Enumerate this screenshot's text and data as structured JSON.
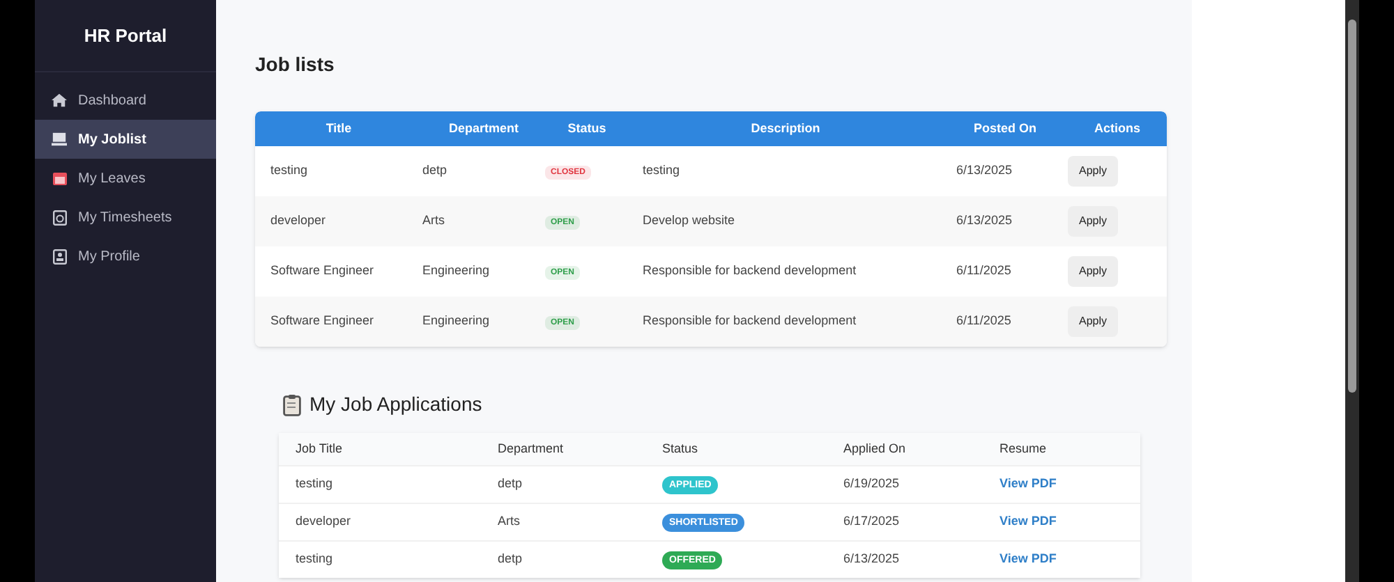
{
  "sidebar": {
    "title": "HR Portal",
    "items": [
      {
        "label": "Dashboard",
        "selected": false
      },
      {
        "label": "My Joblist",
        "selected": true
      },
      {
        "label": "My Leaves",
        "selected": false
      },
      {
        "label": "My Timesheets",
        "selected": false
      },
      {
        "label": "My Profile",
        "selected": false
      }
    ]
  },
  "job_list": {
    "title": "Job lists",
    "columns": [
      "Title",
      "Department",
      "Status",
      "Description",
      "Posted On",
      "Actions"
    ],
    "rows": [
      {
        "title": "testing",
        "department": "detp",
        "status": "CLOSED",
        "color": "#e0353f",
        "description": "testing",
        "posted_on": "6/13/2025",
        "action": "Apply"
      },
      {
        "title": "developer",
        "department": "Arts",
        "status": "OPEN",
        "color": "#2e9e4a",
        "description": "Develop website",
        "posted_on": "6/13/2025",
        "action": "Apply"
      },
      {
        "title": "Software Engineer",
        "department": "Engineering",
        "status": "OPEN",
        "color": "#2e9e4a",
        "description": "Responsible for backend development",
        "posted_on": "6/11/2025",
        "action": "Apply"
      },
      {
        "title": "Software Engineer",
        "department": "Engineering",
        "status": "OPEN",
        "color": "#2e9e4a",
        "description": "Responsible for backend development",
        "posted_on": "6/11/2025",
        "action": "Apply"
      }
    ]
  },
  "applications": {
    "title": "My Job Applications",
    "columns": [
      "Job Title",
      "Department",
      "Status",
      "Applied On",
      "Resume"
    ],
    "rows": [
      {
        "job_title": "testing",
        "department": "detp",
        "status": "APPLIED",
        "color": "#2ec4cc",
        "applied_on": "6/19/2025",
        "resume": "View PDF"
      },
      {
        "job_title": "developer",
        "department": "Arts",
        "status": "SHORTLISTED",
        "color": "#3b8fdc",
        "applied_on": "6/17/2025",
        "resume": "View PDF"
      },
      {
        "job_title": "testing",
        "department": "detp",
        "status": "OFFERED",
        "color": "#2eaa55",
        "applied_on": "6/13/2025",
        "resume": "View PDF"
      }
    ]
  }
}
